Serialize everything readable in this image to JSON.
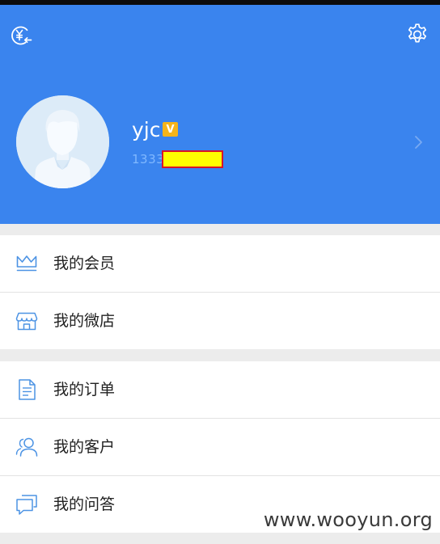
{
  "header": {
    "username": "yjc",
    "vip_badge": "V",
    "phone": "1333",
    "accent_color": "#3a84ee"
  },
  "icons": {
    "wallet": "yuan-wallet-icon",
    "settings": "gear-icon",
    "chevron": "chevron-right-icon"
  },
  "menu": {
    "group1": [
      {
        "label": "我的会员",
        "icon": "crown-icon"
      },
      {
        "label": "我的微店",
        "icon": "shop-icon"
      }
    ],
    "group2": [
      {
        "label": "我的订单",
        "icon": "document-icon"
      },
      {
        "label": "我的客户",
        "icon": "customers-icon"
      },
      {
        "label": "我的问答",
        "icon": "chat-icon"
      }
    ]
  },
  "watermark": "www.wooyun.org"
}
